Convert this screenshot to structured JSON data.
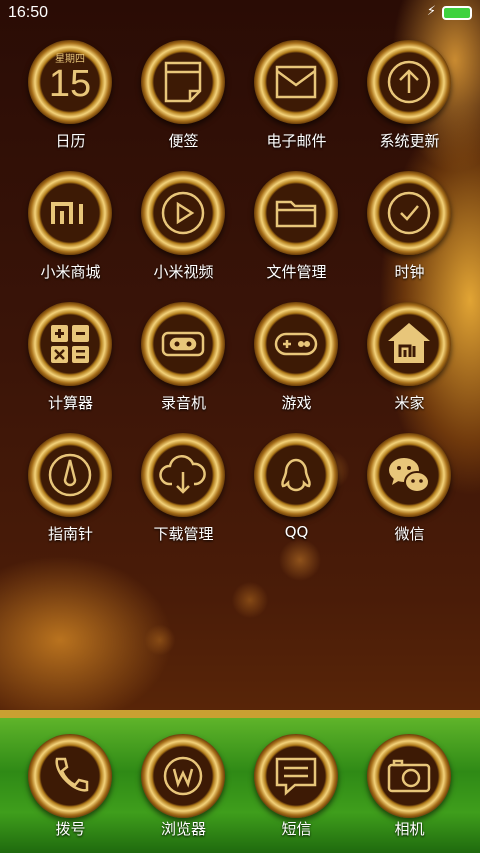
{
  "status_bar": {
    "time": "16:50"
  },
  "calendar": {
    "weekday": "星期四",
    "day": "15"
  },
  "apps": [
    {
      "label": "日历",
      "icon": "calendar-icon"
    },
    {
      "label": "便签",
      "icon": "notes-icon"
    },
    {
      "label": "电子邮件",
      "icon": "mail-icon"
    },
    {
      "label": "系统更新",
      "icon": "update-icon"
    },
    {
      "label": "小米商城",
      "icon": "mi-store-icon"
    },
    {
      "label": "小米视频",
      "icon": "video-icon"
    },
    {
      "label": "文件管理",
      "icon": "folder-icon"
    },
    {
      "label": "时钟",
      "icon": "clock-icon"
    },
    {
      "label": "计算器",
      "icon": "calculator-icon"
    },
    {
      "label": "录音机",
      "icon": "recorder-icon"
    },
    {
      "label": "游戏",
      "icon": "gamepad-icon"
    },
    {
      "label": "米家",
      "icon": "mijia-icon"
    },
    {
      "label": "指南针",
      "icon": "compass-icon"
    },
    {
      "label": "下载管理",
      "icon": "download-icon"
    },
    {
      "label": "QQ",
      "icon": "qq-icon"
    },
    {
      "label": "微信",
      "icon": "wechat-icon"
    }
  ],
  "dock": [
    {
      "label": "拨号",
      "icon": "phone-icon"
    },
    {
      "label": "浏览器",
      "icon": "browser-icon"
    },
    {
      "label": "短信",
      "icon": "message-icon"
    },
    {
      "label": "相机",
      "icon": "camera-icon"
    }
  ],
  "pager": {
    "pages": 3,
    "active": 2
  },
  "colors": {
    "icon_line": "#e8c67a",
    "ring_gold": "#f3d27a",
    "dock_green": "#3f9e1c"
  }
}
